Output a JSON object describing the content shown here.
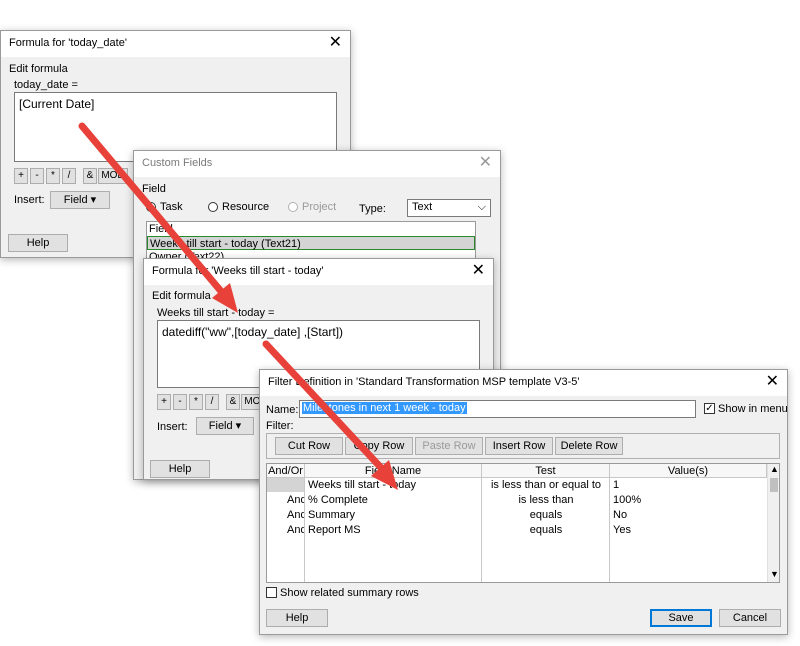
{
  "dialog1": {
    "title": "Formula for 'today_date'",
    "edit_formula_label": "Edit formula",
    "edit_formula_underline": "E",
    "edit_formula_rest": "dit formula",
    "field_label": "today_date =",
    "formula": "[Current Date]",
    "ops": [
      "+",
      "-",
      "*",
      "/",
      "&",
      "MOD"
    ],
    "insert_label": "Insert:",
    "field_button": "Field ▾",
    "help_button": "Help"
  },
  "dialog2": {
    "title": "Custom Fields",
    "field_group": "Field",
    "radio_task": "Task",
    "radio_resource": "Resource",
    "radio_project": "Project",
    "type_label": "Type:",
    "type_value": "Text",
    "list_header": "Field",
    "list_items": [
      "Weeks till start - today (Text21)",
      "Owner (Text22)"
    ]
  },
  "dialog3": {
    "title": "Formula for 'Weeks till start - today'",
    "edit_formula_label": "Edit formula",
    "field_label": "Weeks till start - today =",
    "formula": "datediff(\"ww\",[today_date] ,[Start])",
    "ops": [
      "+",
      "-",
      "*",
      "/",
      "&",
      "MOD"
    ],
    "insert_label": "Insert:",
    "field_button": "Field ▾",
    "help_button": "Help"
  },
  "dialog4": {
    "title": "Filter Definition in 'Standard Transformation MSP template V3-5'",
    "name_label": "Name:",
    "name_value": "Milestones in next 1 week - today",
    "show_in_menu": "Show in menu",
    "filter_label": "Filter:",
    "toolbar": [
      "Cut Row",
      "Copy Row",
      "Paste Row",
      "Insert Row",
      "Delete Row"
    ],
    "columns": [
      "And/Or",
      "Field Name",
      "Test",
      "Value(s)"
    ],
    "rows": [
      {
        "andor": "",
        "field": "Weeks till start - today",
        "test": "is less than or equal to",
        "value": "1"
      },
      {
        "andor": "And",
        "field": "% Complete",
        "test": "is less than",
        "value": "100%"
      },
      {
        "andor": "And",
        "field": "Summary",
        "test": "equals",
        "value": "No"
      },
      {
        "andor": "And",
        "field": "Report MS",
        "test": "equals",
        "value": "Yes"
      }
    ],
    "show_related": "Show related summary rows",
    "help_button": "Help",
    "save_button": "Save",
    "cancel_button": "Cancel"
  },
  "colors": {
    "arrow": "#e8413a",
    "selection": "#3399ff",
    "focus_border": "#0078d7",
    "row_selected": "#d4d4d4"
  }
}
